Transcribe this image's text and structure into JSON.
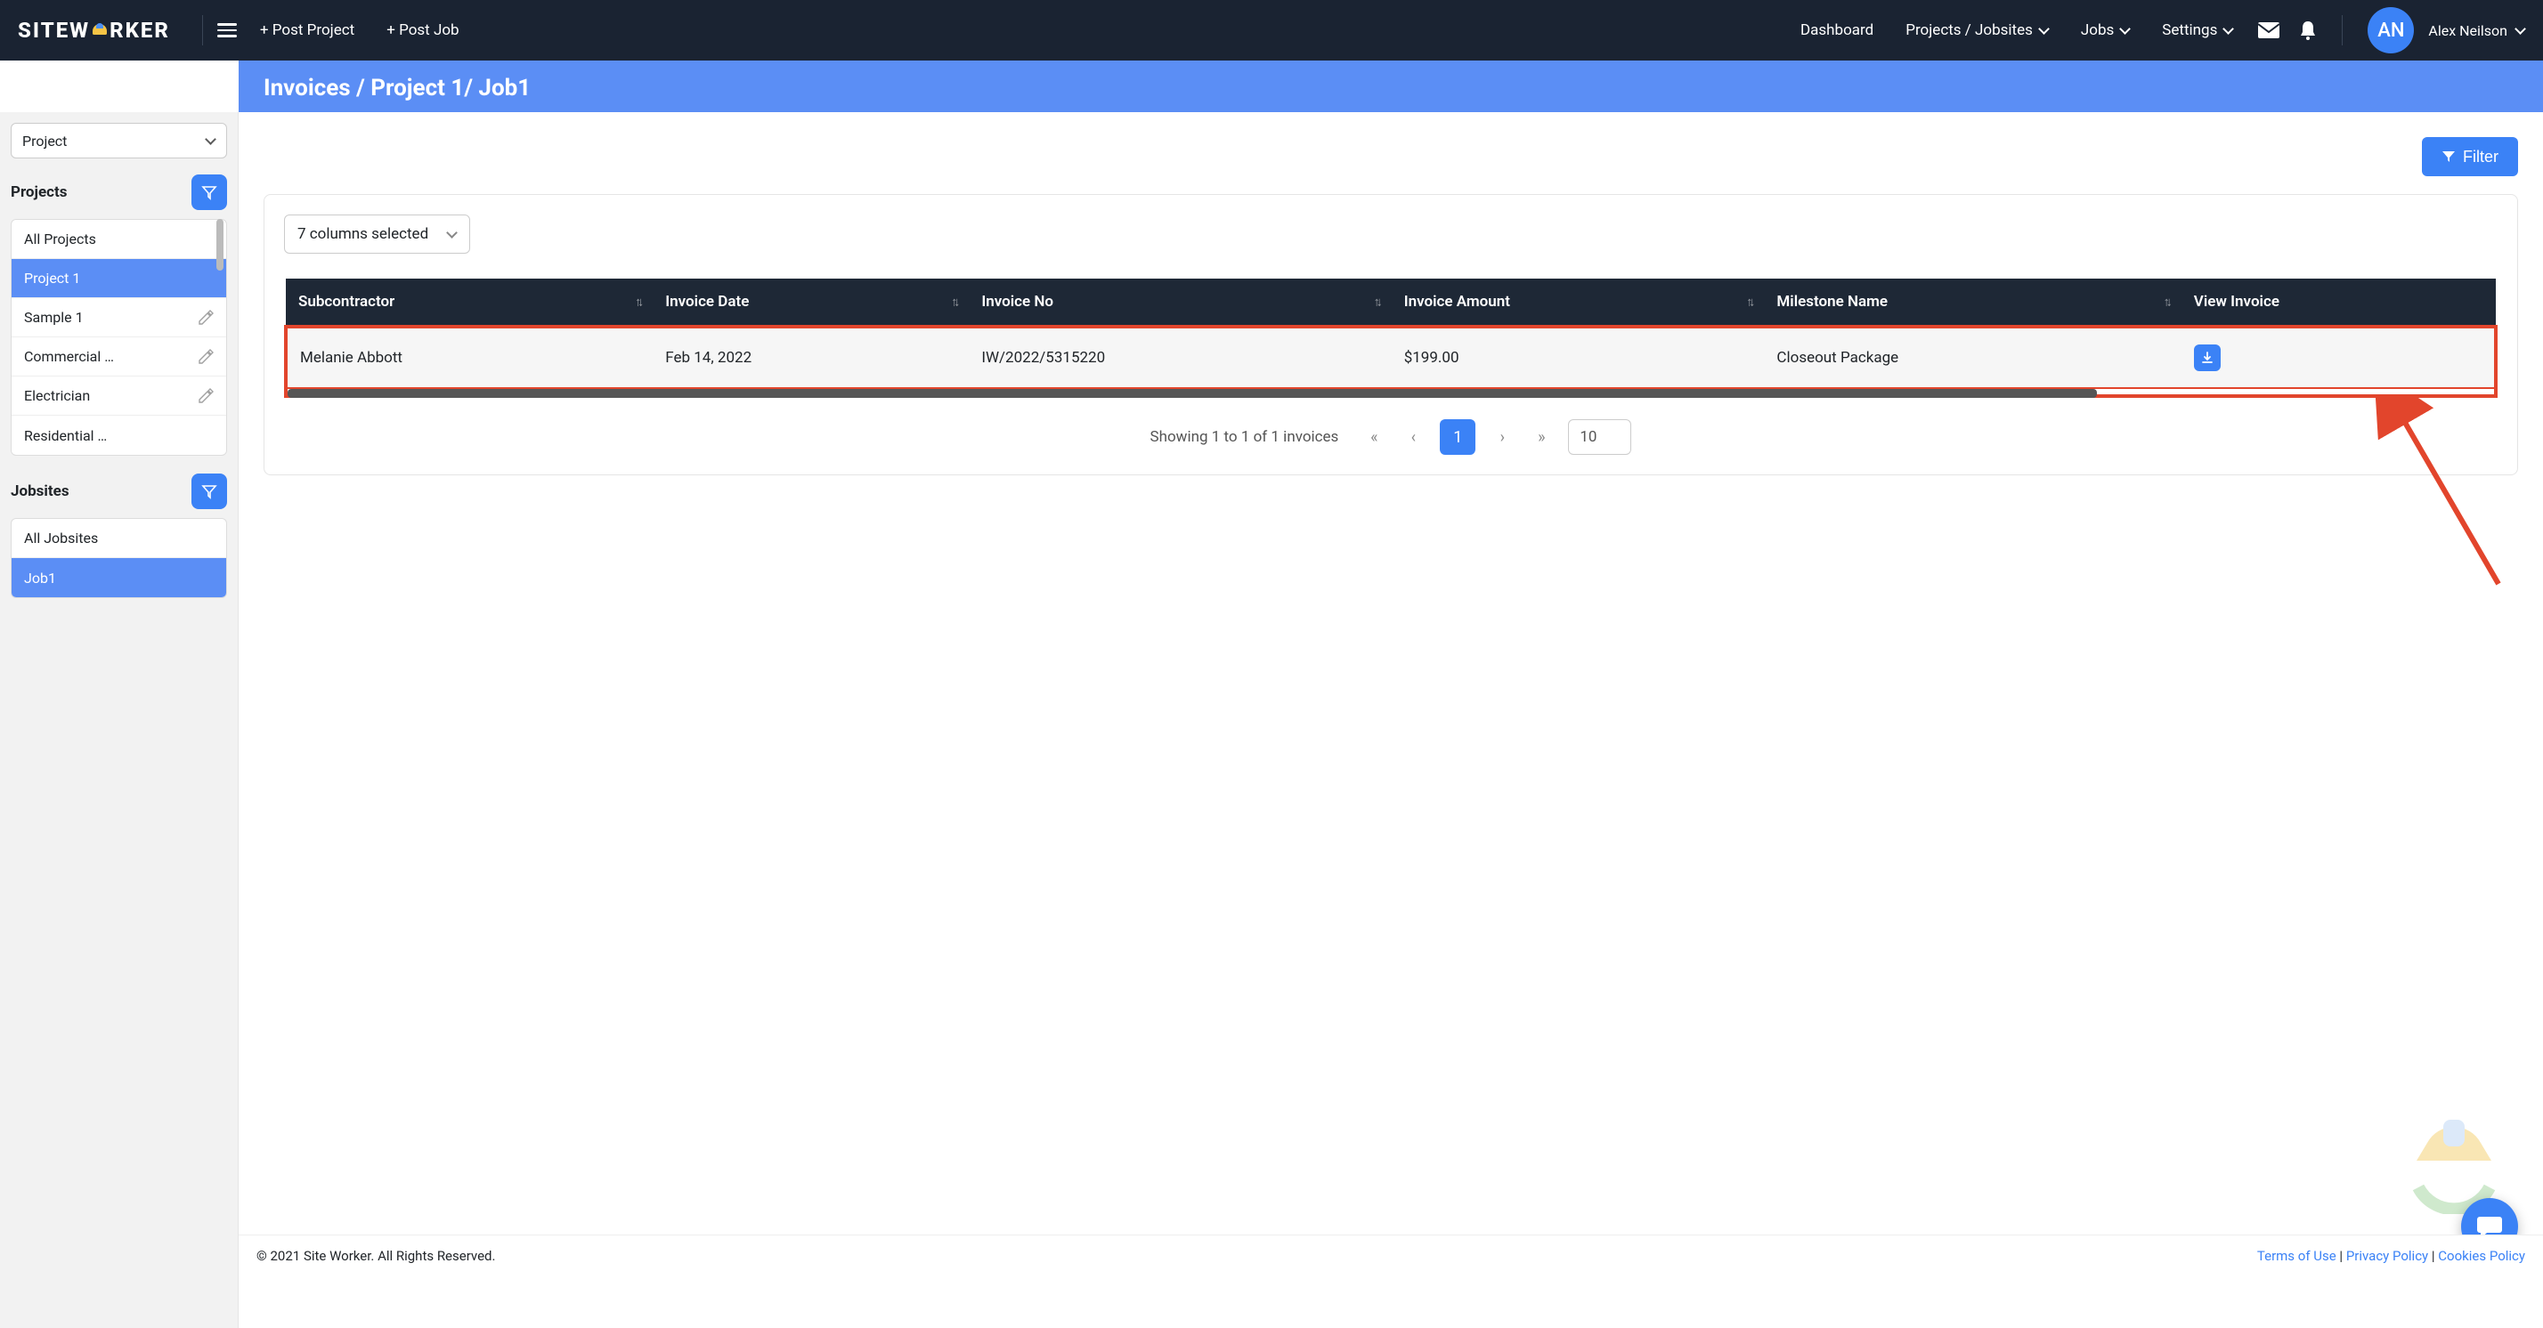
{
  "brand": "SITEWORKER",
  "nav": {
    "post_project": "+ Post Project",
    "post_job": "+ Post Job",
    "dashboard": "Dashboard",
    "projects_jobsites": "Projects / Jobsites",
    "jobs": "Jobs",
    "settings": "Settings",
    "user_initials": "AN",
    "user_name": "Alex Neilson"
  },
  "page_title": "Invoices / Project 1/ Job1",
  "sidebar": {
    "selector_value": "Project",
    "projects_label": "Projects",
    "jobsites_label": "Jobsites",
    "projects": [
      {
        "label": "All Projects",
        "active": false,
        "editable": false
      },
      {
        "label": "Project 1",
        "active": true,
        "editable": false
      },
      {
        "label": "Sample 1",
        "active": false,
        "editable": true
      },
      {
        "label": "Commercial …",
        "active": false,
        "editable": true
      },
      {
        "label": "Electrician",
        "active": false,
        "editable": true
      },
      {
        "label": "Residential …",
        "active": false,
        "editable": false
      }
    ],
    "jobsites": [
      {
        "label": "All Jobsites",
        "active": false
      },
      {
        "label": "Job1",
        "active": true
      }
    ]
  },
  "filter_label": "Filter",
  "columns_selector": "7 columns selected",
  "table": {
    "headers": [
      "Subcontractor",
      "Invoice Date",
      "Invoice No",
      "Invoice Amount",
      "Milestone Name",
      "View Invoice"
    ],
    "rows": [
      {
        "subcontractor": "Melanie Abbott",
        "date": "Feb 14, 2022",
        "no": "IW/2022/5315220",
        "amount": "$199.00",
        "milestone": "Closeout Package"
      }
    ]
  },
  "pager": {
    "summary": "Showing 1 to 1 of 1 invoices",
    "current": "1",
    "page_size": "10"
  },
  "footer": {
    "copyright": "© 2021 Site Worker. All Rights Reserved.",
    "terms": "Terms of Use",
    "privacy": "Privacy Policy",
    "cookies": "Cookies Policy"
  }
}
